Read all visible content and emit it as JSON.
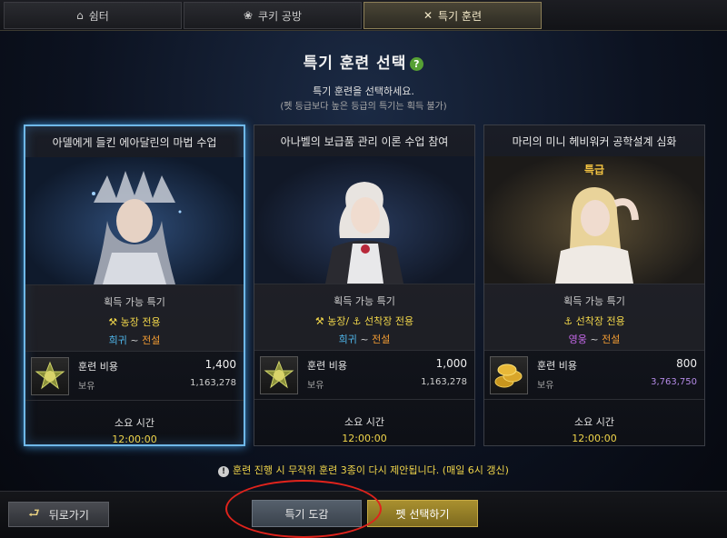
{
  "tabs": [
    {
      "label": "쉼터",
      "icon": "house-icon"
    },
    {
      "label": "쿠키 공방",
      "icon": "paw-icon"
    },
    {
      "label": "특기 훈련",
      "icon": "crossed-swords-icon",
      "active": true
    }
  ],
  "header": {
    "title": "특기 훈련 선택",
    "help": "?",
    "subtitle": "특기 훈련을 선택하세요.",
    "note": "(펫 등급보다 높은 등급의 특기는 획득 불가)"
  },
  "cards": [
    {
      "title": "아델에게 들킨 에아달린의 마법 수업",
      "badge": "",
      "traits_label": "획득 가능 특기",
      "type": "⚒ 농장 전용",
      "grade_from": "희귀",
      "grade_sep": " ~ ",
      "grade_to": "전설",
      "cost_label": "훈련 비용",
      "cost_value": "1,400",
      "owned_label": "보유",
      "owned_value": "1,163,278",
      "time_label": "소요 시간",
      "time_value": "12:00:00",
      "item_icon": "medal-icon",
      "selected": true
    },
    {
      "title": "아나벨의 보급품 관리 이론 수업 참여",
      "badge": "",
      "traits_label": "획득 가능 특기",
      "type": "⚒ 농장/ ⚓ 선착장 전용",
      "grade_from": "희귀",
      "grade_sep": " ~ ",
      "grade_to": "전설",
      "cost_label": "훈련 비용",
      "cost_value": "1,000",
      "owned_label": "보유",
      "owned_value": "1,163,278",
      "time_label": "소요 시간",
      "time_value": "12:00:00",
      "item_icon": "medal-icon",
      "selected": false
    },
    {
      "title": "마리의 미니 헤비워커 공학설계 심화",
      "badge": "특급",
      "traits_label": "획득 가능 특기",
      "type": "⚓ 선착장 전용",
      "grade_from": "영웅",
      "grade_sep": " ~ ",
      "grade_to": "전설",
      "cost_label": "훈련 비용",
      "cost_value": "800",
      "owned_label": "보유",
      "owned_value": "3,763,750",
      "time_label": "소요 시간",
      "time_value": "12:00:00",
      "item_icon": "gold-coins-icon",
      "selected": false
    }
  ],
  "notice": "훈련 진행 시 무작위 훈련 3종이 다시 제안됩니다. (매일 6시 갱신)",
  "buttons": {
    "back": "뒤로가기",
    "dex": "특기 도감",
    "select_pet": "펫 선택하기"
  },
  "colors": {
    "accent_gold": "#f0d54a",
    "rare": "#4fb6ea",
    "hero": "#c468e8",
    "legend": "#ef9a33",
    "selected_glow": "#6fb8e8",
    "annotation_red": "#e0231c"
  }
}
